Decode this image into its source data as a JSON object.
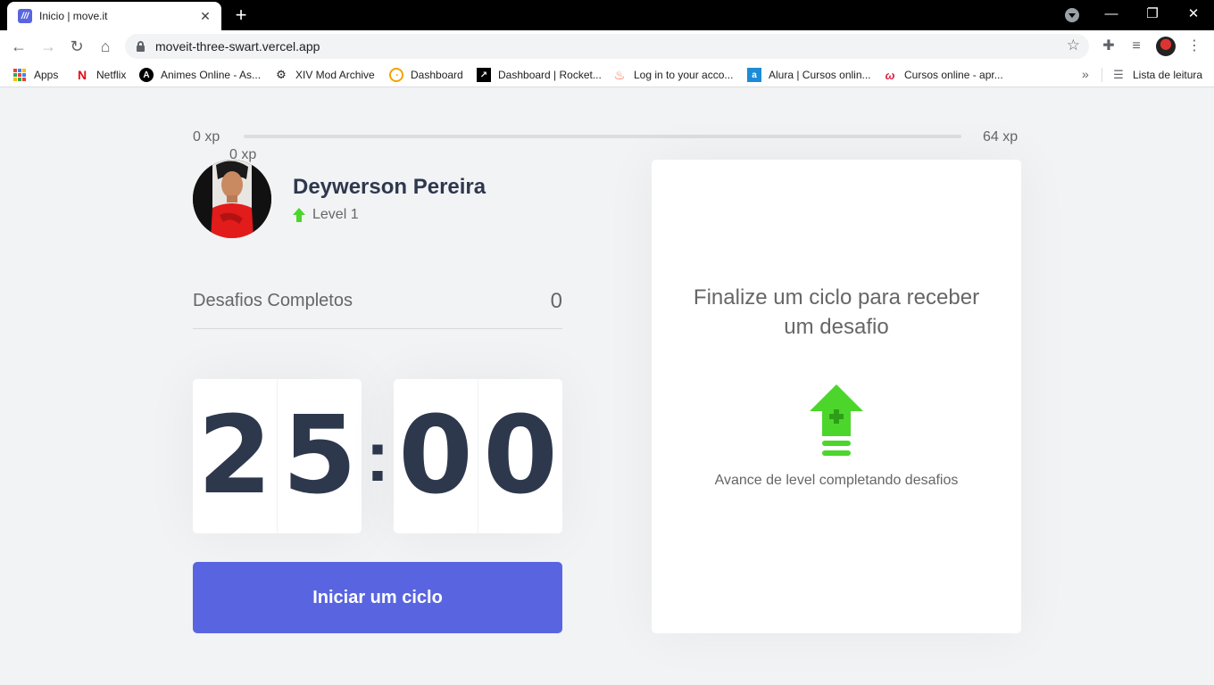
{
  "browser": {
    "tab_title": "Inicio | move.it",
    "url": "moveit-three-swart.vercel.app",
    "bookmarks": [
      {
        "label": "Apps",
        "icon": "apps-grid-icon"
      },
      {
        "label": "Netflix",
        "icon": "netflix-icon"
      },
      {
        "label": "Animes Online - As...",
        "icon": "anime-icon"
      },
      {
        "label": "XIV Mod Archive",
        "icon": "xiv-icon"
      },
      {
        "label": "Dashboard",
        "icon": "dashboard-icon"
      },
      {
        "label": "Dashboard | Rocket...",
        "icon": "rocketseat-icon"
      },
      {
        "label": "Log in to your acco...",
        "icon": "tinder-icon"
      },
      {
        "label": "Alura | Cursos onlin...",
        "icon": "alura-icon"
      },
      {
        "label": "Cursos online - apr...",
        "icon": "udemy-icon"
      }
    ],
    "reading_list": "Lista de leitura"
  },
  "experience": {
    "start_label": "0 xp",
    "end_label": "64 xp",
    "current_label": "0 xp",
    "current_fraction": 0
  },
  "profile": {
    "name": "Deywerson Pereira",
    "level_label": "Level 1"
  },
  "completed": {
    "label": "Desafios Completos",
    "count": "0"
  },
  "countdown": {
    "minute_left": "2",
    "minute_right": "5",
    "separator": ":",
    "second_left": "0",
    "second_right": "0"
  },
  "start_button": {
    "label": "Iniciar um ciclo"
  },
  "challenge_box": {
    "title": "Finalize um ciclo para receber um desafio",
    "description": "Avance de level completando desafios"
  },
  "colors": {
    "accent": "#5965e0",
    "green": "#4cd62b",
    "title": "#2e384d",
    "text": "#666666",
    "background": "#f2f3f5"
  }
}
